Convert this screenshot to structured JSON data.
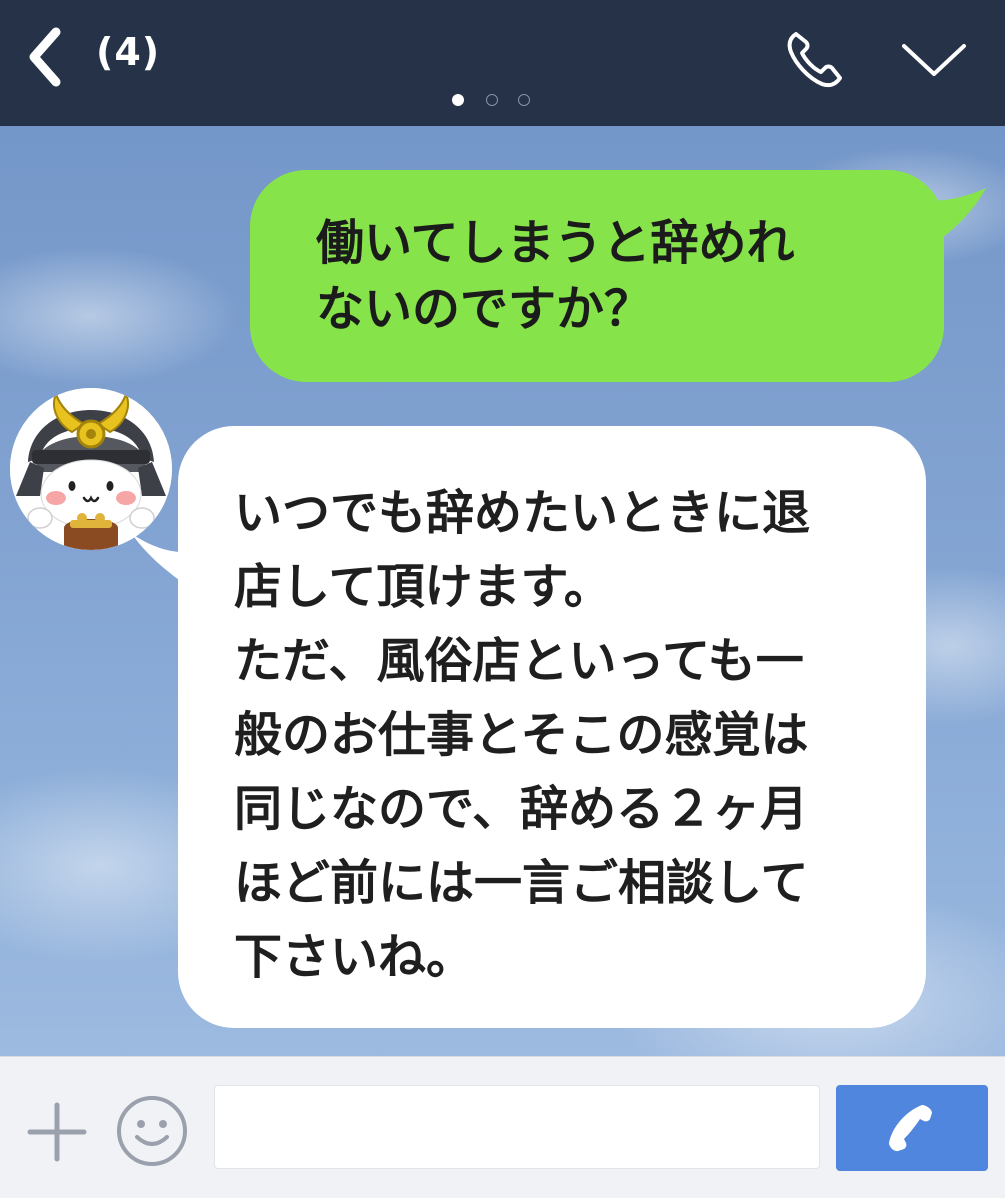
{
  "header": {
    "count_label": "(4)",
    "icons": {
      "back": "chevron-left-icon",
      "call": "phone-icon",
      "menu": "chevron-down-icon"
    },
    "page_indicator": {
      "total": 3,
      "active": 1
    }
  },
  "chat": {
    "messages": [
      {
        "direction": "outgoing",
        "text": "働いてしまうと辞めれ\nないのですか？"
      },
      {
        "direction": "incoming",
        "text": "いつでも辞めたいときに退\n店して頂けます。\nただ、風俗店といっても一\n般のお仕事とそこの感覚は\n同じなので、辞める２ヶ月\nほど前には一言ご相談して\n下さいね。"
      }
    ]
  },
  "input_bar": {
    "message_value": "",
    "icons": {
      "plus": "plus-icon",
      "emoji": "smiley-icon",
      "send": "phone-icon"
    }
  },
  "colors": {
    "header_bg": "#253247",
    "chat_bg": "#7fa0cf",
    "outgoing_bubble": "#86e44a",
    "incoming_bubble": "#ffffff",
    "send_button": "#5186de"
  }
}
